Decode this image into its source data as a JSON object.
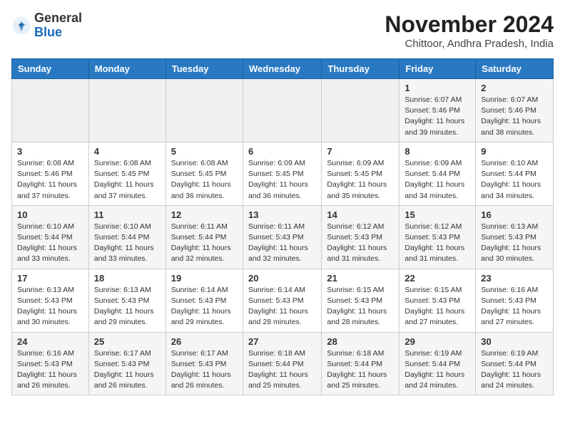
{
  "logo": {
    "general": "General",
    "blue": "Blue"
  },
  "header": {
    "month": "November 2024",
    "location": "Chittoor, Andhra Pradesh, India"
  },
  "days_of_week": [
    "Sunday",
    "Monday",
    "Tuesday",
    "Wednesday",
    "Thursday",
    "Friday",
    "Saturday"
  ],
  "weeks": [
    [
      {
        "day": "",
        "info": ""
      },
      {
        "day": "",
        "info": ""
      },
      {
        "day": "",
        "info": ""
      },
      {
        "day": "",
        "info": ""
      },
      {
        "day": "",
        "info": ""
      },
      {
        "day": "1",
        "info": "Sunrise: 6:07 AM\nSunset: 5:46 PM\nDaylight: 11 hours and 39 minutes."
      },
      {
        "day": "2",
        "info": "Sunrise: 6:07 AM\nSunset: 5:46 PM\nDaylight: 11 hours and 38 minutes."
      }
    ],
    [
      {
        "day": "3",
        "info": "Sunrise: 6:08 AM\nSunset: 5:46 PM\nDaylight: 11 hours and 37 minutes."
      },
      {
        "day": "4",
        "info": "Sunrise: 6:08 AM\nSunset: 5:45 PM\nDaylight: 11 hours and 37 minutes."
      },
      {
        "day": "5",
        "info": "Sunrise: 6:08 AM\nSunset: 5:45 PM\nDaylight: 11 hours and 36 minutes."
      },
      {
        "day": "6",
        "info": "Sunrise: 6:09 AM\nSunset: 5:45 PM\nDaylight: 11 hours and 36 minutes."
      },
      {
        "day": "7",
        "info": "Sunrise: 6:09 AM\nSunset: 5:45 PM\nDaylight: 11 hours and 35 minutes."
      },
      {
        "day": "8",
        "info": "Sunrise: 6:09 AM\nSunset: 5:44 PM\nDaylight: 11 hours and 34 minutes."
      },
      {
        "day": "9",
        "info": "Sunrise: 6:10 AM\nSunset: 5:44 PM\nDaylight: 11 hours and 34 minutes."
      }
    ],
    [
      {
        "day": "10",
        "info": "Sunrise: 6:10 AM\nSunset: 5:44 PM\nDaylight: 11 hours and 33 minutes."
      },
      {
        "day": "11",
        "info": "Sunrise: 6:10 AM\nSunset: 5:44 PM\nDaylight: 11 hours and 33 minutes."
      },
      {
        "day": "12",
        "info": "Sunrise: 6:11 AM\nSunset: 5:44 PM\nDaylight: 11 hours and 32 minutes."
      },
      {
        "day": "13",
        "info": "Sunrise: 6:11 AM\nSunset: 5:43 PM\nDaylight: 11 hours and 32 minutes."
      },
      {
        "day": "14",
        "info": "Sunrise: 6:12 AM\nSunset: 5:43 PM\nDaylight: 11 hours and 31 minutes."
      },
      {
        "day": "15",
        "info": "Sunrise: 6:12 AM\nSunset: 5:43 PM\nDaylight: 11 hours and 31 minutes."
      },
      {
        "day": "16",
        "info": "Sunrise: 6:13 AM\nSunset: 5:43 PM\nDaylight: 11 hours and 30 minutes."
      }
    ],
    [
      {
        "day": "17",
        "info": "Sunrise: 6:13 AM\nSunset: 5:43 PM\nDaylight: 11 hours and 30 minutes."
      },
      {
        "day": "18",
        "info": "Sunrise: 6:13 AM\nSunset: 5:43 PM\nDaylight: 11 hours and 29 minutes."
      },
      {
        "day": "19",
        "info": "Sunrise: 6:14 AM\nSunset: 5:43 PM\nDaylight: 11 hours and 29 minutes."
      },
      {
        "day": "20",
        "info": "Sunrise: 6:14 AM\nSunset: 5:43 PM\nDaylight: 11 hours and 28 minutes."
      },
      {
        "day": "21",
        "info": "Sunrise: 6:15 AM\nSunset: 5:43 PM\nDaylight: 11 hours and 28 minutes."
      },
      {
        "day": "22",
        "info": "Sunrise: 6:15 AM\nSunset: 5:43 PM\nDaylight: 11 hours and 27 minutes."
      },
      {
        "day": "23",
        "info": "Sunrise: 6:16 AM\nSunset: 5:43 PM\nDaylight: 11 hours and 27 minutes."
      }
    ],
    [
      {
        "day": "24",
        "info": "Sunrise: 6:16 AM\nSunset: 5:43 PM\nDaylight: 11 hours and 26 minutes."
      },
      {
        "day": "25",
        "info": "Sunrise: 6:17 AM\nSunset: 5:43 PM\nDaylight: 11 hours and 26 minutes."
      },
      {
        "day": "26",
        "info": "Sunrise: 6:17 AM\nSunset: 5:43 PM\nDaylight: 11 hours and 26 minutes."
      },
      {
        "day": "27",
        "info": "Sunrise: 6:18 AM\nSunset: 5:44 PM\nDaylight: 11 hours and 25 minutes."
      },
      {
        "day": "28",
        "info": "Sunrise: 6:18 AM\nSunset: 5:44 PM\nDaylight: 11 hours and 25 minutes."
      },
      {
        "day": "29",
        "info": "Sunrise: 6:19 AM\nSunset: 5:44 PM\nDaylight: 11 hours and 24 minutes."
      },
      {
        "day": "30",
        "info": "Sunrise: 6:19 AM\nSunset: 5:44 PM\nDaylight: 11 hours and 24 minutes."
      }
    ]
  ]
}
